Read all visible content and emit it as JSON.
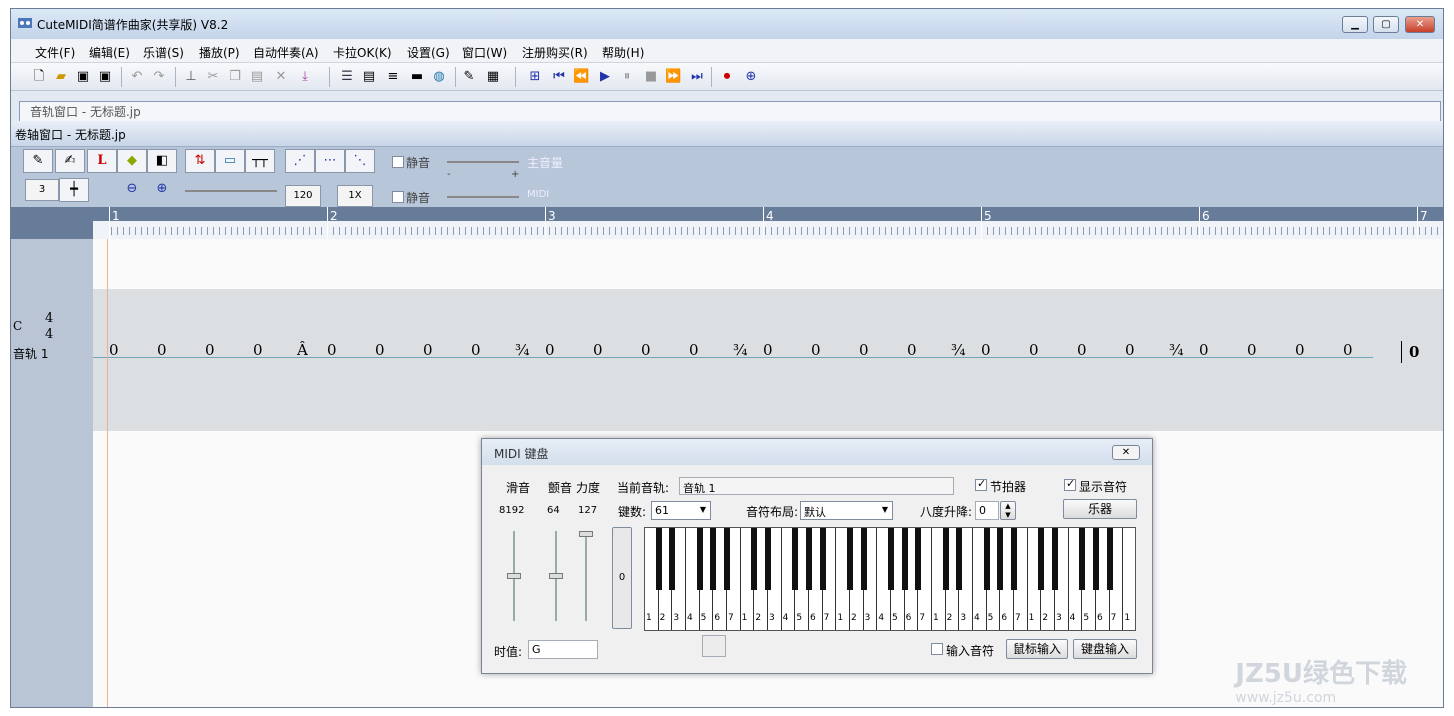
{
  "window": {
    "title": "CuteMIDI简谱作曲家(共享版) V8.2",
    "min": "▁",
    "max": "▢",
    "close": "✕"
  },
  "menu": [
    "文件(F)",
    "编辑(E)",
    "乐谱(S)",
    "播放(P)",
    "自动伴奏(A)",
    "卡拉OK(K)",
    "设置(G)",
    "窗口(W)",
    "注册购买(R)",
    "帮助(H)"
  ],
  "tab": {
    "label": "音轨窗口 - 无标题.jp"
  },
  "subwindow": {
    "title": "卷轴窗口 - 无标题.jp"
  },
  "controls": {
    "mute1": "静音",
    "mute2": "静音",
    "volume_label": "主音量",
    "midi_label": "MIDI",
    "minus": "-",
    "plus": "+",
    "num3": "3",
    "tempo": "120",
    "speed": "1X"
  },
  "ruler": {
    "bars": [
      "1",
      "2",
      "3",
      "4",
      "5",
      "6",
      "7"
    ]
  },
  "track": {
    "key": "C",
    "time_sig_top": "4",
    "time_sig_bottom": "4",
    "track_label": "音轨 1",
    "notes": [
      "0",
      "0",
      "0",
      "0",
      "Â",
      "0",
      "0",
      "0",
      "0",
      "¾",
      "0",
      "0",
      "0",
      "0",
      "¾",
      "0",
      "0",
      "0",
      "0",
      "¾",
      "0",
      "0",
      "0",
      "0",
      "¾",
      "0",
      "0",
      "0",
      "0"
    ],
    "end_note": "0"
  },
  "dialog": {
    "title": "MIDI 键盘",
    "close": "✕",
    "pitch_label": "滑音",
    "vibrato_label": "颤音",
    "velocity_label": "力度",
    "pitch_value": "8192",
    "vibrato_value": "64",
    "velocity_value": "127",
    "current_track_label": "当前音轨:",
    "current_track_value": "音轨 1",
    "metronome_label": "节拍器",
    "show_notes_label": "显示音符",
    "keys_label": "键数:",
    "keys_value": "61",
    "layout_label": "音符布局:",
    "layout_value": "默认",
    "octave_label": "八度升降:",
    "octave_value": "0",
    "instrument_button": "乐器",
    "zero_button": "0",
    "duration_label": "时值:",
    "duration_value": "G",
    "input_notes_label": "输入音符",
    "mouse_input_button": "鼠标输入",
    "keyboard_input_button": "键盘输入",
    "key_labels": [
      "1",
      "2",
      "3",
      "4",
      "5",
      "6",
      "7",
      "1",
      "2",
      "3",
      "4",
      "5",
      "6",
      "7",
      "1",
      "2",
      "3",
      "4",
      "5",
      "6",
      "7",
      "1",
      "2",
      "3",
      "4",
      "5",
      "6",
      "7",
      "1",
      "2",
      "3",
      "4",
      "5",
      "6",
      "7",
      "1"
    ]
  },
  "watermark": {
    "main": "JZ5U绿色下载",
    "sub": "www.jz5u.com"
  }
}
